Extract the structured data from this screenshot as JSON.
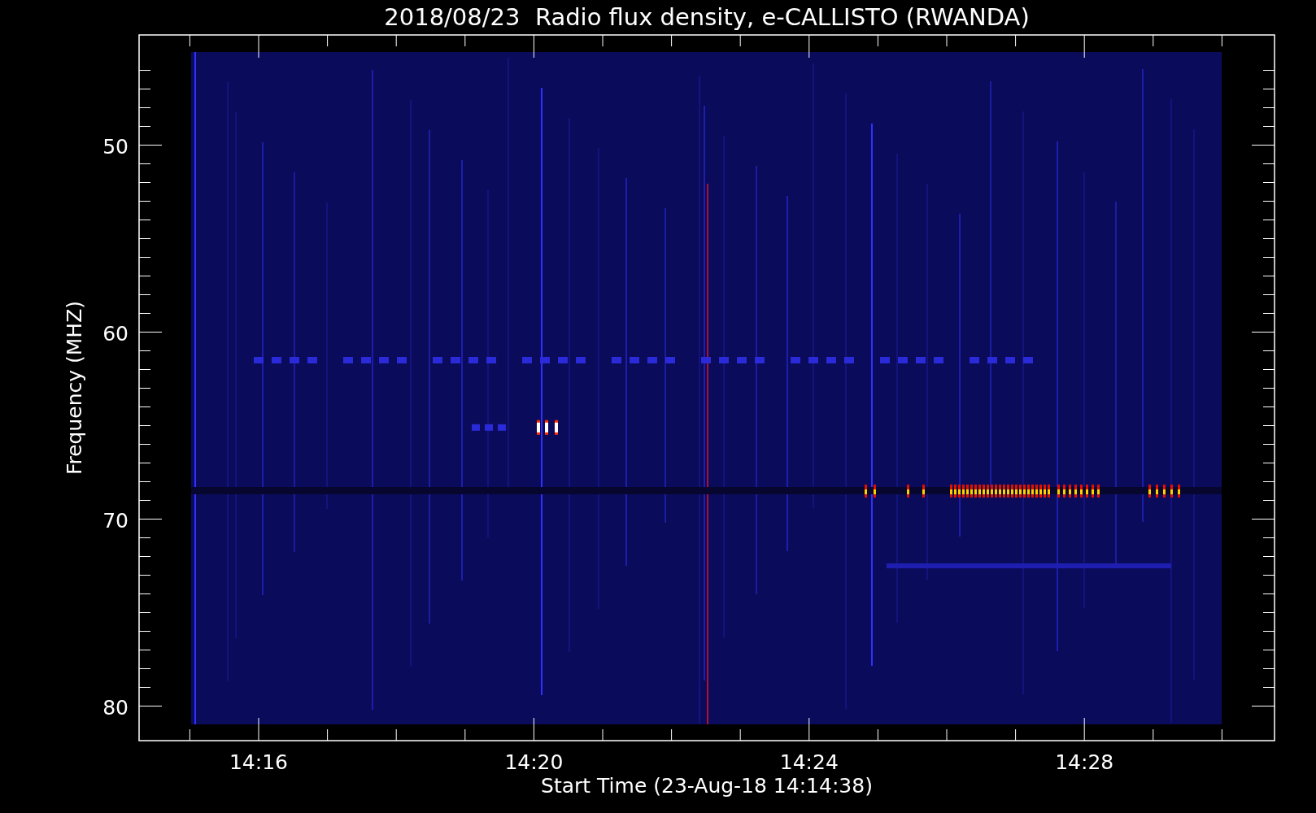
{
  "title": "2018/08/23  Radio flux density, e-CALLISTO (RWANDA)",
  "y_axis": {
    "label": "Frequency (MHZ)",
    "ticks": [
      "50",
      "60",
      "70",
      "80"
    ]
  },
  "x_axis": {
    "label": "Start Time (23-Aug-18 14:14:38)",
    "ticks": [
      "14:16",
      "14:20",
      "14:24",
      "14:28"
    ]
  }
}
